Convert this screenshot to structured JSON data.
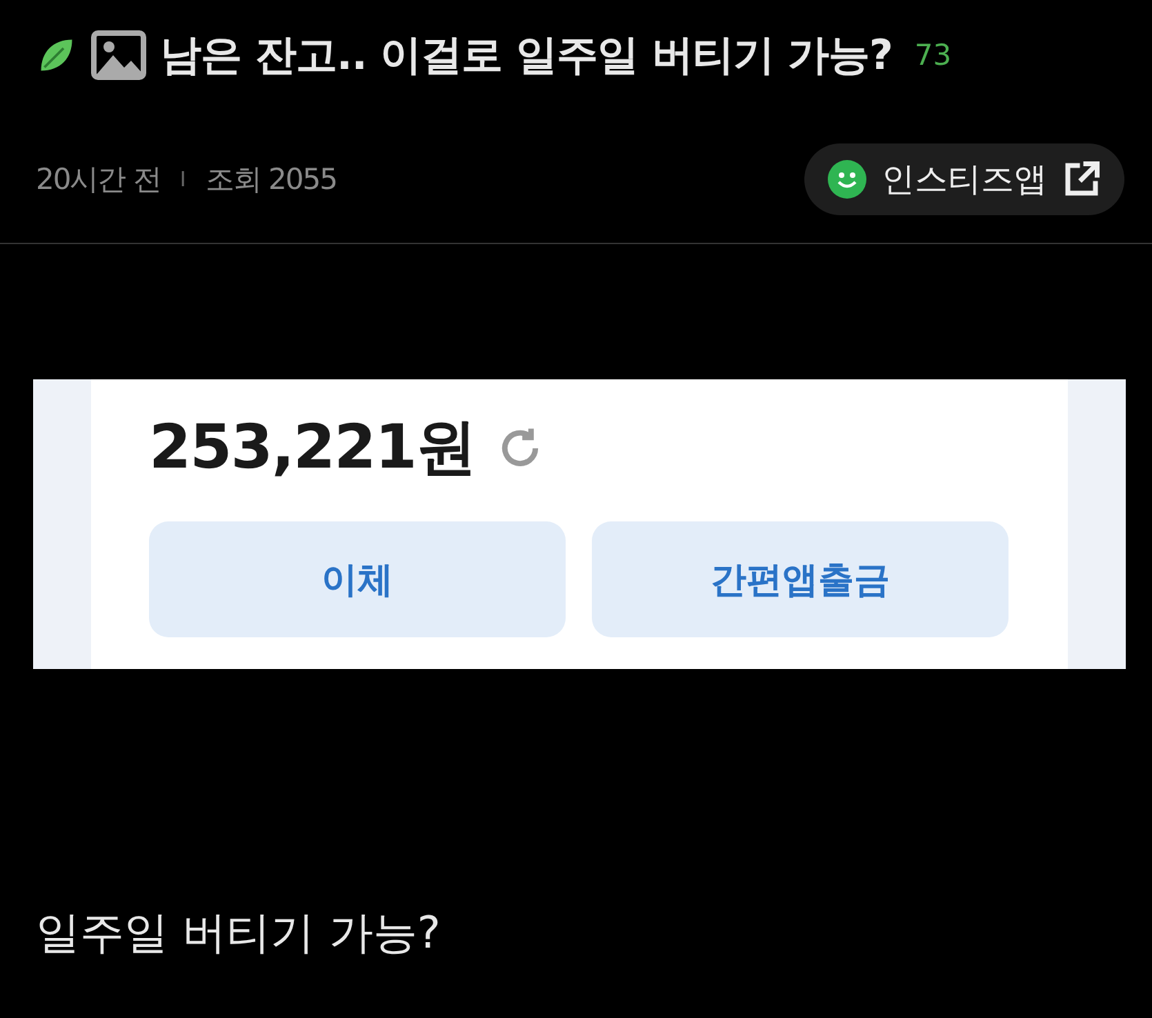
{
  "post": {
    "title": "남은 잔고.. 이걸로 일주일 버티기 가능?",
    "comment_count": "73",
    "time": "20시간 전",
    "separator": "I",
    "views": "조회 2055",
    "app_button": "인스티즈앱"
  },
  "image": {
    "balance": "253,221원",
    "buttons": [
      "이체",
      "간편앱출금"
    ]
  },
  "body": "일주일 버티기 가능?"
}
